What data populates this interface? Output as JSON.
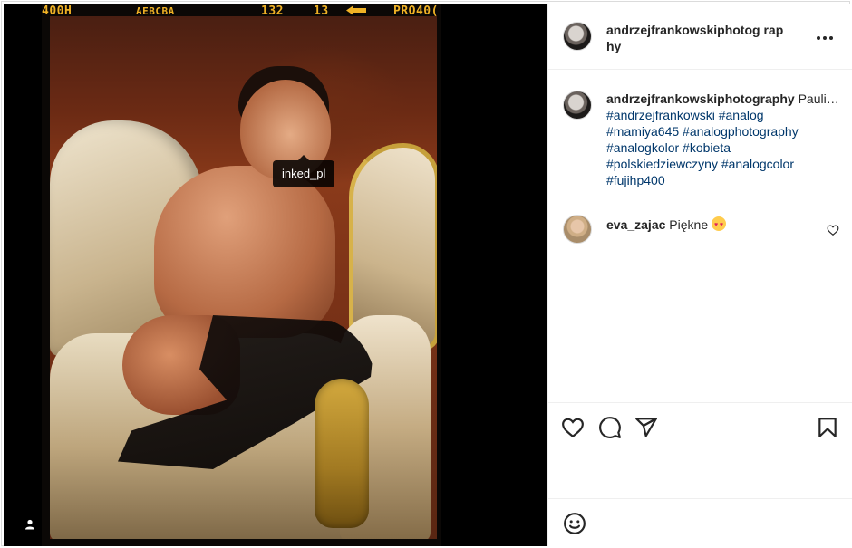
{
  "film_edge": {
    "labels": [
      "400H",
      "AEBCBA",
      "132",
      "13",
      "PRO40("
    ]
  },
  "photo_tag": {
    "username": "inked_pl"
  },
  "post": {
    "author": "andrzejfrankowskiphotography",
    "header_author": "andrzejfrankowskiphotog raphy",
    "caption_start": "Paulina...",
    "hashtags": "#andrzejfrankowski #analog #mamiya645 #analogphotography #analogkolor #kobieta #polskiedziewczyny #analogcolor #fujihp400"
  },
  "comments": [
    {
      "username": "eva_zajac",
      "text": "Piękne"
    }
  ],
  "icons": {
    "more": "more-horizontal-icon",
    "like": "heart-icon",
    "comment": "comment-icon",
    "share": "paper-plane-icon",
    "save": "bookmark-icon",
    "emoji": "smiley-icon",
    "tagged_user": "user-icon"
  },
  "colors": {
    "film_edge_text": "#f0b225",
    "hashtag_link": "#00376b",
    "border": "#efefef"
  }
}
